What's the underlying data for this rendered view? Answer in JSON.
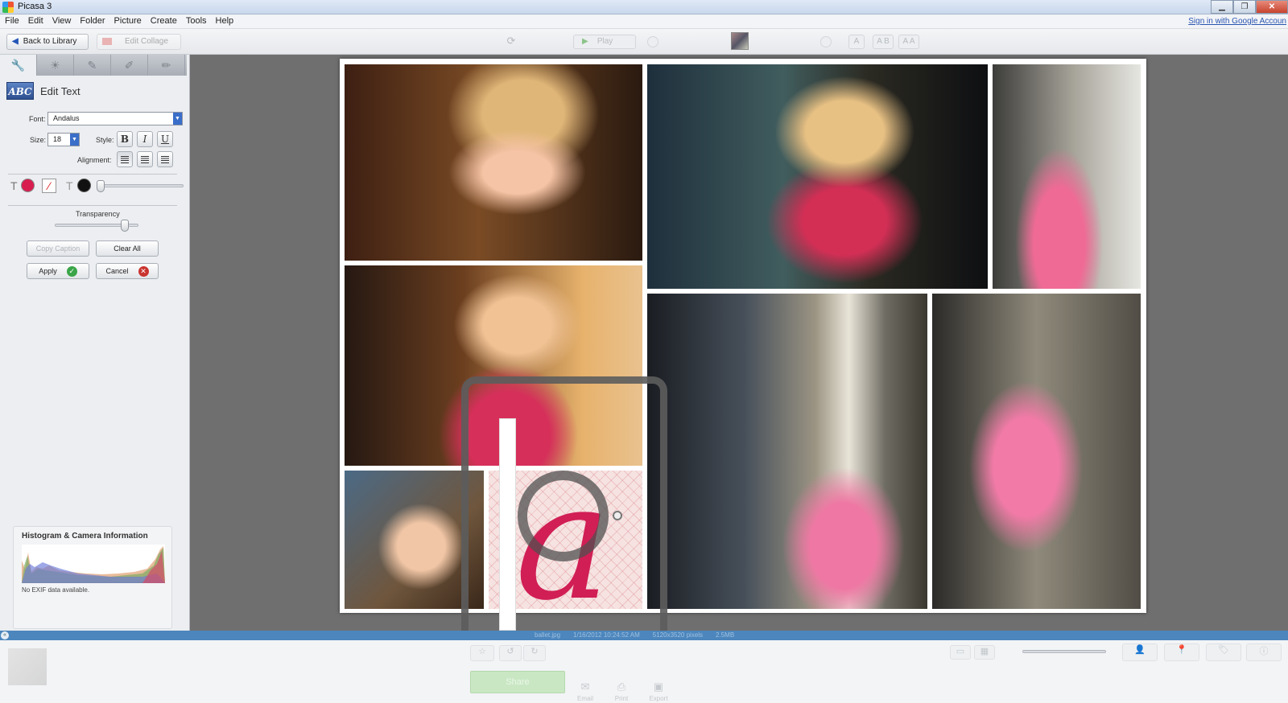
{
  "window": {
    "title": "Picasa 3",
    "min": "▁",
    "max": "❐",
    "close": "✕"
  },
  "menu": {
    "items": [
      "File",
      "Edit",
      "View",
      "Folder",
      "Picture",
      "Create",
      "Tools",
      "Help"
    ],
    "signin": "Sign in with Google Accoun"
  },
  "toolbar": {
    "back_label": "Back to Library",
    "edit_collage_label": "Edit Collage",
    "play_label": "Play",
    "caption_a": "A",
    "caption_ab": "A B",
    "caption_aa": "A A"
  },
  "sidebar": {
    "tab_icons": [
      "wrench-icon",
      "sun-icon",
      "brush-icon",
      "brush-2-icon",
      "brush-3-icon"
    ],
    "edit_text_icon_text": "ABC",
    "edit_text_title": "Edit Text",
    "font_label": "Font:",
    "font_value": "Andalus",
    "size_label": "Size:",
    "size_value": "18",
    "style_label": "Style:",
    "bold": "B",
    "italic": "I",
    "underline": "U",
    "alignment_label": "Alignment:",
    "text_color": "#d81e4f",
    "outline_color": "#111111",
    "t_glyph": "T",
    "transparency_label": "Transparency",
    "transparency": 0.87,
    "copy_caption_label": "Copy Caption",
    "clear_all_label": "Clear All",
    "apply_label": "Apply",
    "cancel_label": "Cancel",
    "histogram_title": "Histogram & Camera Information",
    "histogram_note": "No EXIF data available."
  },
  "canvas": {
    "text_glyph": "a",
    "text_color": "#d11e55"
  },
  "status": {
    "filename": "ballet.jpg",
    "date": "1/16/2012 10:24:52 AM",
    "dimensions": "5120x3520 pixels",
    "size": "2.5MB"
  },
  "tray": {
    "share_label": "Share",
    "email_label": "Email",
    "print_label": "Print",
    "export_label": "Export"
  },
  "colors": {
    "accent_blue": "#4c86bd",
    "apply_green": "#3aa548",
    "cancel_red": "#c9342f"
  }
}
